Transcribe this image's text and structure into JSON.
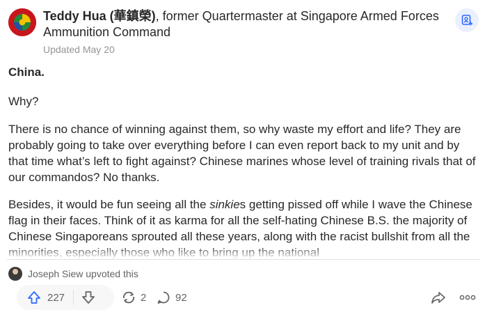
{
  "author": {
    "name": "Teddy Hua (華鎮榮)",
    "credential": ", former Quartermaster at Singapore Armed Forces Ammunition Command",
    "updated": "Updated May 20"
  },
  "answer": {
    "heading": "China.",
    "why": "Why?",
    "para1": "There is no chance of winning against them, so why waste my effort and life? They are probably going to take over everything before I can even report back to my unit and by that time what’s left to fight against? Chinese marines whose level of training rivals that of our commandos? No thanks.",
    "para2_pre": "Besides, it would be fun seeing all the ",
    "para2_em": "sinkie",
    "para2_post": "s getting pissed off while I wave the Chinese flag in their faces. Think of it as karma for all the self-hating Chinese B.S. the majority of Chinese Singaporeans sprouted all these years, along with the racist bullshit from all the minorities, especially those who like to bring up the national"
  },
  "upvoter": {
    "text": "Joseph Siew upvoted this"
  },
  "actions": {
    "upvotes": "227",
    "reshares": "2",
    "comments": "92"
  },
  "icons": [
    "upvote-icon",
    "downvote-icon",
    "reshare-icon",
    "comment-icon",
    "share-icon",
    "more-icon",
    "follow-icon"
  ],
  "colors": {
    "brand_avatar": "#c8161d",
    "muted": "#636466",
    "follow_bg": "#ebf0ff",
    "follow_icon": "#2e69ff"
  }
}
